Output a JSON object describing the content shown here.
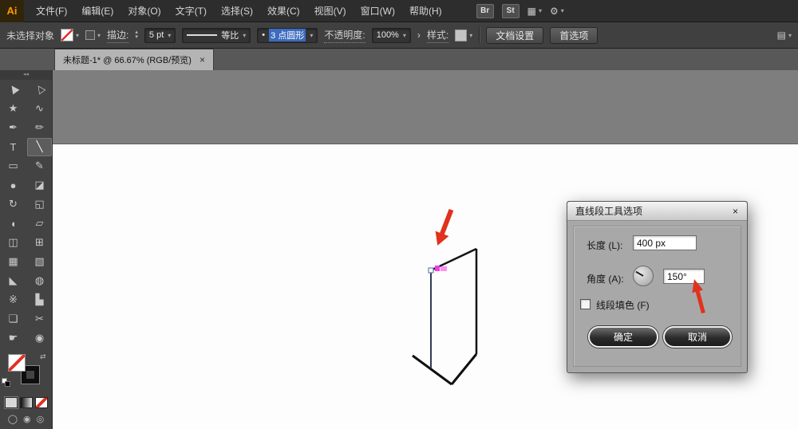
{
  "colors": {
    "arrow-red": "#e0321c",
    "anchor-magenta": "#f23ae6",
    "anchor-magenta-light": "#ff8df5",
    "selected-line": "#2f3d52",
    "highlight-blue": "#3d6bbf"
  },
  "icons": {
    "caret": "▾",
    "stepper_up": "▴",
    "stepper_down": "▾",
    "swap": "⇄",
    "collapse": "◂◂",
    "close": "×",
    "panel_menu": "▤",
    "arrange": "▦",
    "gear": "⚙",
    "chevron": "›",
    "bullet": "•"
  },
  "menubar": {
    "logo": "Ai",
    "items": [
      {
        "id": "file",
        "label": "文件(F)"
      },
      {
        "id": "edit",
        "label": "编辑(E)"
      },
      {
        "id": "object",
        "label": "对象(O)"
      },
      {
        "id": "type",
        "label": "文字(T)"
      },
      {
        "id": "select",
        "label": "选择(S)"
      },
      {
        "id": "effect",
        "label": "效果(C)"
      },
      {
        "id": "view",
        "label": "视图(V)"
      },
      {
        "id": "window",
        "label": "窗口(W)"
      },
      {
        "id": "help",
        "label": "帮助(H)"
      }
    ],
    "badges": [
      "Br",
      "St"
    ]
  },
  "controlbar": {
    "selection_status": "未选择对象",
    "stroke_label": "描边:",
    "stroke_weight": "5 pt",
    "profile_label": "等比",
    "brush_name": "3 点圆形",
    "opacity_label": "不透明度:",
    "opacity_value": "100%",
    "style_label": "样式:",
    "doc_setup_button": "文档设置",
    "preferences_button": "首选项"
  },
  "tab": {
    "title": "未标题-1* @ 66.67% (RGB/预览)"
  },
  "toolbar": {
    "drawing_modes": [
      "◯",
      "◉",
      "◎"
    ],
    "tools": [
      {
        "name": "selection-tool",
        "glyph": "▶",
        "rot": -125
      },
      {
        "name": "direct-selection-tool",
        "glyph": "▷",
        "rot": -125
      },
      {
        "name": "magic-wand-tool",
        "glyph": "★"
      },
      {
        "name": "lasso-tool",
        "glyph": "∿"
      },
      {
        "name": "pen-tool",
        "glyph": "✒"
      },
      {
        "name": "pencil-tool",
        "glyph": "✏"
      },
      {
        "name": "type-tool",
        "glyph": "T"
      },
      {
        "name": "line-segment-tool",
        "glyph": "╲",
        "selected": true
      },
      {
        "name": "rectangle-tool",
        "glyph": "▭"
      },
      {
        "name": "paintbrush-tool",
        "glyph": "✎"
      },
      {
        "name": "blob-brush-tool",
        "glyph": "●"
      },
      {
        "name": "eraser-tool",
        "glyph": "◪"
      },
      {
        "name": "rotate-tool",
        "glyph": "↻"
      },
      {
        "name": "scale-tool",
        "glyph": "◱"
      },
      {
        "name": "width-tool",
        "glyph": "◖"
      },
      {
        "name": "free-transform-tool",
        "glyph": "▱"
      },
      {
        "name": "shape-builder-tool",
        "glyph": "◫"
      },
      {
        "name": "perspective-grid-tool",
        "glyph": "⊞"
      },
      {
        "name": "mesh-tool",
        "glyph": "▦"
      },
      {
        "name": "gradient-tool",
        "glyph": "▧"
      },
      {
        "name": "eyedropper-tool",
        "glyph": "◣"
      },
      {
        "name": "blend-tool",
        "glyph": "◍"
      },
      {
        "name": "symbol-sprayer-tool",
        "glyph": "※"
      },
      {
        "name": "column-graph-tool",
        "glyph": "▙"
      },
      {
        "name": "artboard-tool",
        "glyph": "❏"
      },
      {
        "name": "slice-tool",
        "glyph": "✂"
      },
      {
        "name": "hand-tool",
        "glyph": "☛"
      },
      {
        "name": "zoom-tool",
        "glyph": "◉"
      }
    ]
  },
  "dialog": {
    "title": "直线段工具选项",
    "length_label": "长度 (L):",
    "length_value": "400 px",
    "angle_label": "角度 (A):",
    "angle_value": "150°",
    "fill_checkbox_label": "线段填色 (F)",
    "ok_button": "确定",
    "cancel_button": "取消"
  }
}
